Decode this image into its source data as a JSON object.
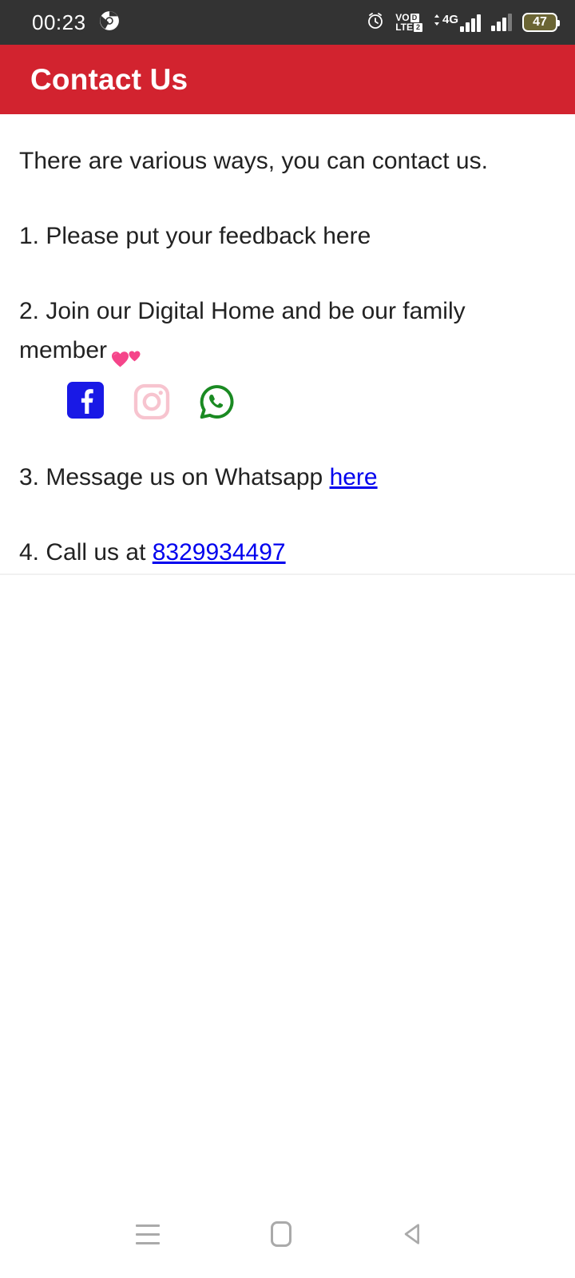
{
  "status_bar": {
    "time": "00:23",
    "browser_icon": "chrome-icon",
    "alarm_icon": "alarm-clock-icon",
    "volte": {
      "top": "VO",
      "bottom": "LTE",
      "badge_top": "D",
      "badge_bottom": "2"
    },
    "network_label": "4G",
    "battery_level": "47",
    "colors": {
      "background": "#333333",
      "foreground": "#ffffff",
      "battery_fill": "#6b6534"
    }
  },
  "header": {
    "title": "Contact Us",
    "background": "#d2232f",
    "text_color": "#ffffff"
  },
  "content": {
    "intro": "There are various ways, you can contact us.",
    "item1": "1. Please put your feedback here",
    "item2": "2. Join our Digital Home and be our family member",
    "item2_emoji": "two-hearts-emoji",
    "item3_prefix": "3. Message us on Whatsapp ",
    "item3_link": "here",
    "item4_prefix": "4. Call us at ",
    "item4_link": "8329934497",
    "link_color": "#0000ee",
    "text_color": "#222222",
    "social": [
      {
        "name": "facebook-icon",
        "label": "Facebook",
        "color": "#1919e6"
      },
      {
        "name": "instagram-icon",
        "label": "Instagram",
        "color": "#f7c4cf"
      },
      {
        "name": "whatsapp-icon",
        "label": "WhatsApp",
        "color": "#1a8a22"
      }
    ]
  },
  "nav_bar": {
    "recents": "recents-icon",
    "home": "home-icon",
    "back": "back-icon",
    "color": "#aaaaaa"
  }
}
